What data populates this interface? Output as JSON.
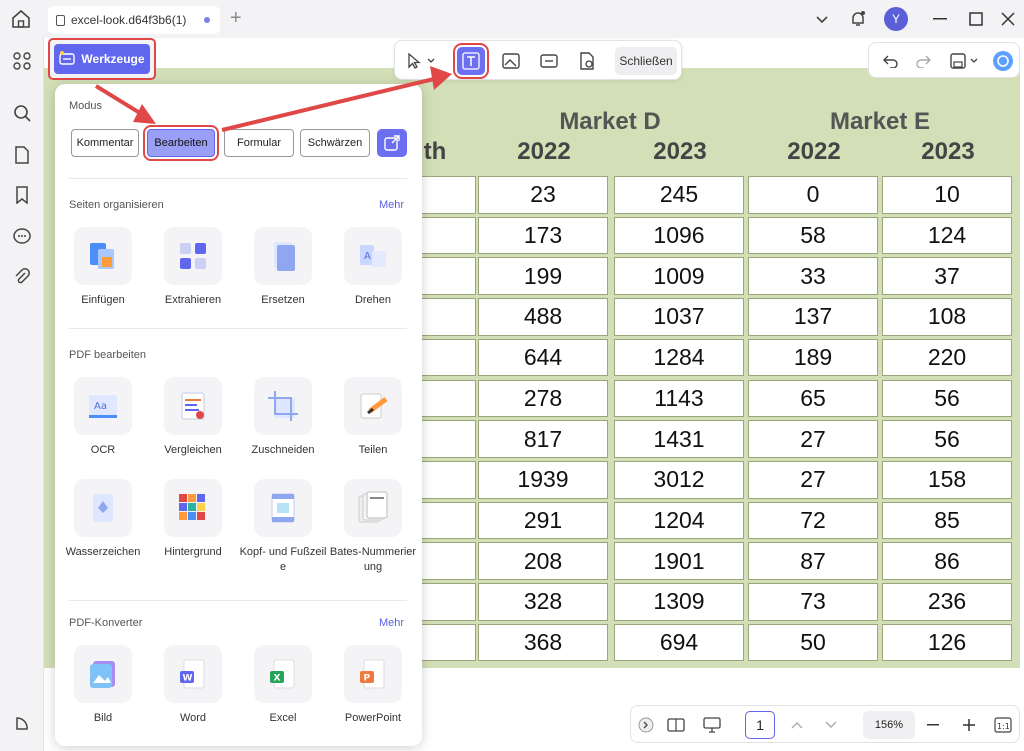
{
  "titlebar": {
    "tab_title": "excel-look.d64f3b6(1)",
    "avatar_letter": "Y"
  },
  "werkzeuge": {
    "label": "Werkzeuge"
  },
  "edit_toolbar": {
    "close_label": "Schließen"
  },
  "panel": {
    "modus": {
      "title": "Modus",
      "buttons": [
        "Kommentar",
        "Bearbeiten",
        "Formular",
        "Schwärzen"
      ],
      "active": "Bearbeiten"
    },
    "organize": {
      "title": "Seiten organisieren",
      "more": "Mehr",
      "tools": [
        "Einfügen",
        "Extrahieren",
        "Ersetzen",
        "Drehen"
      ]
    },
    "edit": {
      "title": "PDF bearbeiten",
      "tools_row1": [
        "OCR",
        "Vergleichen",
        "Zuschneiden",
        "Teilen"
      ],
      "tools_row2": [
        "Wasserzeichen",
        "Hintergrund",
        "Kopf- und Fußzeile",
        "Bates-Nummerierung"
      ]
    },
    "convert": {
      "title": "PDF-Konverter",
      "more": "Mehr",
      "tools": [
        "Bild",
        "Word",
        "Excel",
        "PowerPoint"
      ]
    }
  },
  "table": {
    "groups": [
      "Market D",
      "Market E"
    ],
    "years": [
      "2022",
      "2023",
      "2022",
      "2023"
    ],
    "partial_header": "th",
    "rows": [
      [
        "23",
        "245",
        "0",
        "10"
      ],
      [
        "173",
        "1096",
        "58",
        "124"
      ],
      [
        "199",
        "1009",
        "33",
        "37"
      ],
      [
        "488",
        "1037",
        "137",
        "108"
      ],
      [
        "644",
        "1284",
        "189",
        "220"
      ],
      [
        "278",
        "1143",
        "65",
        "56"
      ],
      [
        "817",
        "1431",
        "27",
        "56"
      ],
      [
        "1939",
        "3012",
        "27",
        "158"
      ],
      [
        "291",
        "1204",
        "72",
        "85"
      ],
      [
        "208",
        "1901",
        "87",
        "86"
      ],
      [
        "328",
        "1309",
        "73",
        "236"
      ],
      [
        "368",
        "694",
        "50",
        "126"
      ]
    ]
  },
  "bottombar": {
    "page": "1",
    "zoom": "156%",
    "fit_label": "1:1"
  },
  "colors": {
    "accent": "#6166ef",
    "highlight": "#e04848",
    "table_bg": "#d3dfb7"
  }
}
